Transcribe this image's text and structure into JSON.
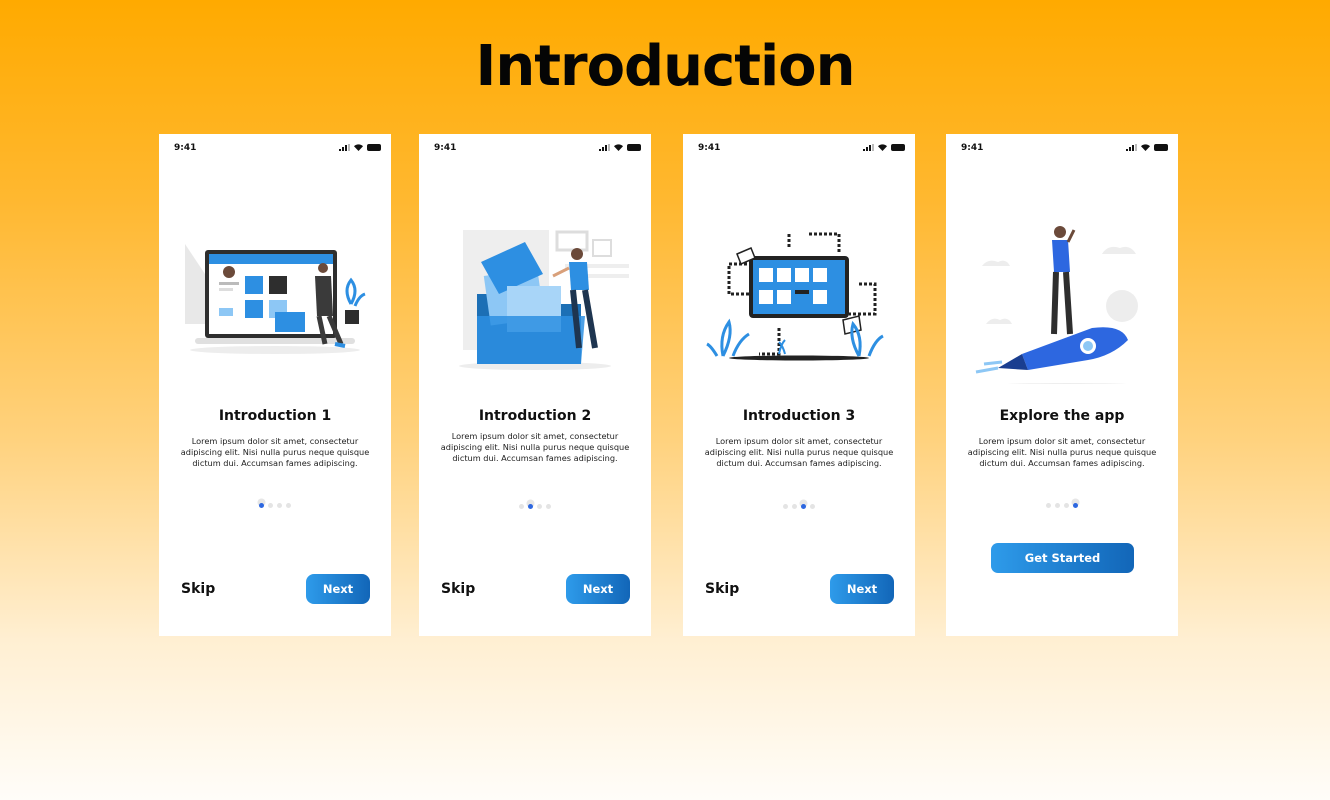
{
  "page": {
    "title": "Introduction"
  },
  "status_bar": {
    "time": "9:41"
  },
  "screens": [
    {
      "title": "Introduction 1",
      "description": "Lorem ipsum dolor sit amet, consectetur adipiscing elit. Nisi nulla purus neque quisque dictum dui. Accumsan fames adipiscing.",
      "active_page": 1,
      "page_count": 4,
      "skip_label": "Skip",
      "next_label": "Next"
    },
    {
      "title": "Introduction 2",
      "description": "Lorem ipsum dolor sit amet, consectetur adipiscing elit. Nisi nulla purus neque quisque dictum dui. Accumsan fames adipiscing.",
      "active_page": 2,
      "page_count": 4,
      "skip_label": "Skip",
      "next_label": "Next"
    },
    {
      "title": "Introduction 3",
      "description": "Lorem ipsum dolor sit amet, consectetur adipiscing elit. Nisi nulla purus neque quisque dictum dui. Accumsan fames adipiscing.",
      "active_page": 3,
      "page_count": 4,
      "skip_label": "Skip",
      "next_label": "Next"
    },
    {
      "title": "Explore the app",
      "description": "Lorem ipsum dolor sit amet, consectetur adipiscing elit. Nisi nulla purus neque quisque dictum dui. Accumsan fames adipiscing.",
      "active_page": 4,
      "page_count": 4,
      "cta_label": "Get Started"
    }
  ],
  "colors": {
    "accent_blue": "#2D67E0",
    "button_gradient_start": "#2E9BEA",
    "button_gradient_end": "#1266B8",
    "background_top": "#FFAA00",
    "background_bottom": "#FFFDF9"
  },
  "icons": [
    "signal-icon",
    "wifi-icon",
    "battery-icon"
  ]
}
